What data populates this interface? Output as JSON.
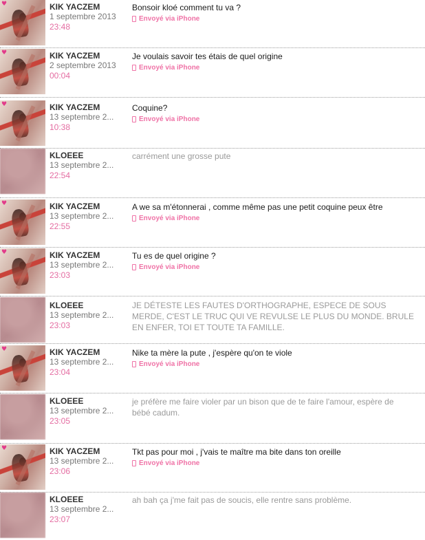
{
  "messages": [
    {
      "author": "KIK YACZEM",
      "date": "1 septembre 2013",
      "time": "23:48",
      "text": "Bonsoir kloé comment tu va ?",
      "via": "Envoyé via iPhone",
      "avatar": "kik"
    },
    {
      "author": "KIK YACZEM",
      "date": "2 septembre 2013",
      "time": "00:04",
      "text": "Je voulais savoir tes étais de quel origine",
      "via": "Envoyé via iPhone",
      "avatar": "kik"
    },
    {
      "author": "KIK YACZEM",
      "date": "13 septembre 2...",
      "time": "10:38",
      "text": "Coquine?",
      "via": "Envoyé via iPhone",
      "avatar": "kik"
    },
    {
      "author": "KLOEEE",
      "date": "13 septembre 2...",
      "time": "22:54",
      "text": "carrément une grosse pute",
      "via": "",
      "avatar": "kloe"
    },
    {
      "author": "KIK YACZEM",
      "date": "13 septembre 2...",
      "time": "22:55",
      "text": "A we sa m'étonnerai , comme même pas une petit coquine peux être",
      "via": "Envoyé via iPhone",
      "avatar": "kik"
    },
    {
      "author": "KIK YACZEM",
      "date": "13 septembre 2...",
      "time": "23:03",
      "text": "Tu es de quel origine ?",
      "via": "Envoyé via iPhone",
      "avatar": "kik"
    },
    {
      "author": "KLOEEE",
      "date": "13 septembre 2...",
      "time": "23:03",
      "text": "JE DÉTESTE LES FAUTES D'ORTHOGRAPHE, ESPECE DE SOUS MERDE, C'EST LE TRUC QUI VE REVULSE LE PLUS DU MONDE. BRULE EN ENFER, TOI ET TOUTE TA FAMILLE.",
      "via": "",
      "avatar": "kloe"
    },
    {
      "author": "KIK YACZEM",
      "date": "13 septembre 2...",
      "time": "23:04",
      "text": "Nike ta mère la pute , j'espère qu'on te viole",
      "via": "Envoyé via iPhone",
      "avatar": "kik"
    },
    {
      "author": "KLOEEE",
      "date": "13 septembre 2...",
      "time": "23:05",
      "text": "je préfère me faire violer par un bison que de te faire l'amour, espère de bébé cadum.",
      "via": "",
      "avatar": "kloe"
    },
    {
      "author": "KIK YACZEM",
      "date": "13 septembre 2...",
      "time": "23:06",
      "text": "Tkt pas pour moi , j'vais te maître ma bite dans ton oreille",
      "via": "Envoyé via iPhone",
      "avatar": "kik"
    },
    {
      "author": "KLOEEE",
      "date": "13 septembre 2...",
      "time": "23:07",
      "text": "ah bah ça j'me fait pas de soucis, elle rentre sans problème.",
      "via": "",
      "avatar": "kloe"
    }
  ]
}
